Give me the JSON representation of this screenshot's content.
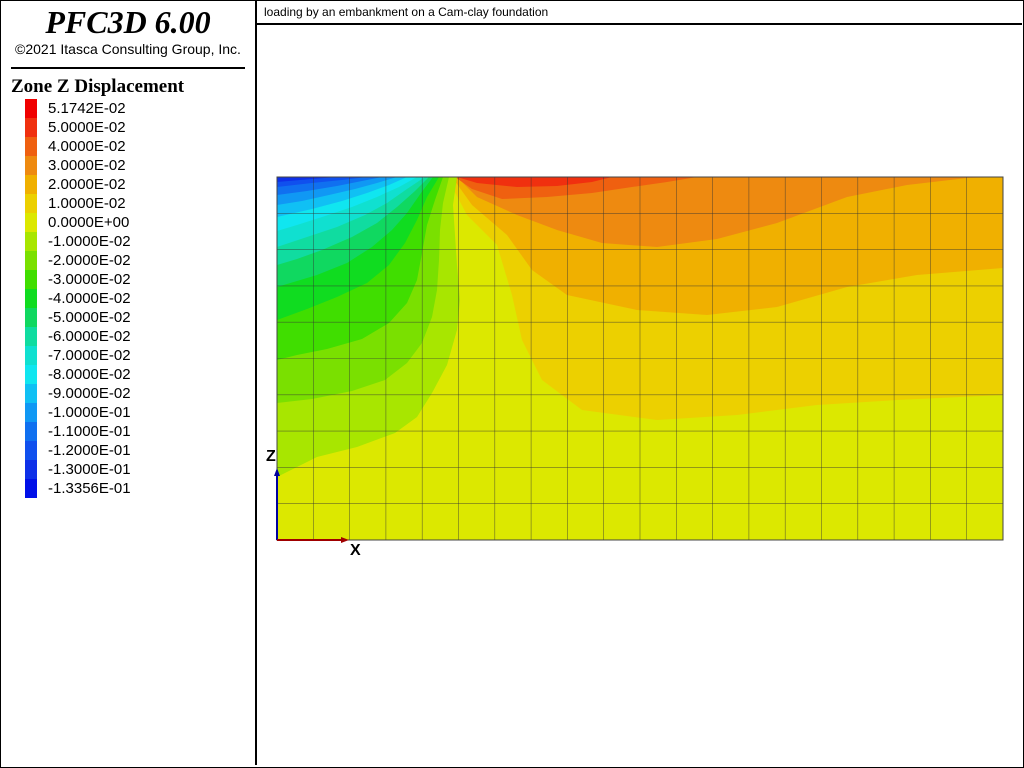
{
  "app": {
    "title": "PFC3D 6.00",
    "copyright": "©2021 Itasca Consulting Group, Inc."
  },
  "plot": {
    "title": "loading by an embankment on a Cam-clay foundation"
  },
  "legend": {
    "title": "Zone Z Displacement",
    "items": [
      {
        "label": "5.1742E-02",
        "color": "#f00000"
      },
      {
        "label": "5.0000E-02",
        "color": "#f0300f"
      },
      {
        "label": "4.0000E-02",
        "color": "#ef6010"
      },
      {
        "label": "3.0000E-02",
        "color": "#ee8a10"
      },
      {
        "label": "2.0000E-02",
        "color": "#f0b000"
      },
      {
        "label": "1.0000E-02",
        "color": "#ecd000"
      },
      {
        "label": "0.0000E+00",
        "color": "#dce800"
      },
      {
        "label": "-1.0000E-02",
        "color": "#a8e600"
      },
      {
        "label": "-2.0000E-02",
        "color": "#7ae000"
      },
      {
        "label": "-3.0000E-02",
        "color": "#40de00"
      },
      {
        "label": "-4.0000E-02",
        "color": "#10dc20"
      },
      {
        "label": "-5.0000E-02",
        "color": "#10d860"
      },
      {
        "label": "-6.0000E-02",
        "color": "#10dca0"
      },
      {
        "label": "-7.0000E-02",
        "color": "#10e0d0"
      },
      {
        "label": "-8.0000E-02",
        "color": "#10e6f0"
      },
      {
        "label": "-9.0000E-02",
        "color": "#10c0f4"
      },
      {
        "label": "-1.0000E-01",
        "color": "#1098f4"
      },
      {
        "label": "-1.1000E-01",
        "color": "#1070f0"
      },
      {
        "label": "-1.2000E-01",
        "color": "#1050ee"
      },
      {
        "label": "-1.3000E-01",
        "color": "#0e30e8"
      },
      {
        "label": "-1.3356E-01",
        "color": "#0010e8"
      }
    ]
  },
  "axes": {
    "z_label": "Z",
    "x_label": "X",
    "z_color": "#0000a0",
    "x_color": "#a00000"
  },
  "grid": {
    "columns": 20,
    "rows": 10
  }
}
